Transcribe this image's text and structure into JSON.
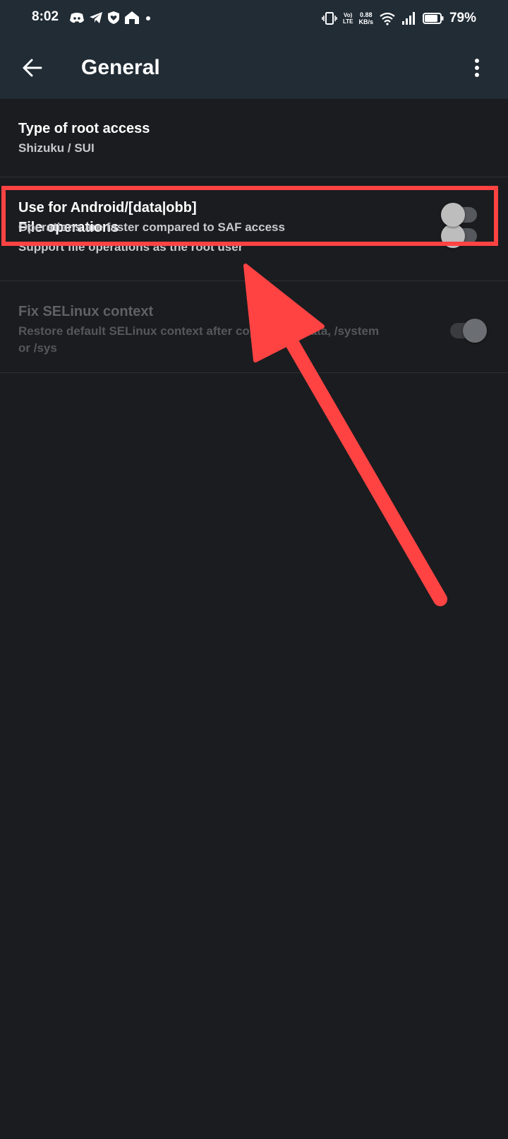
{
  "status_bar": {
    "time": "8:02",
    "volte_top": "Vo)",
    "volte_bottom": "LTE",
    "net_speed_value": "0.88",
    "net_speed_unit": "KB/s",
    "battery_percent": "79%",
    "left_icons": [
      "discord-icon",
      "telegram-icon",
      "shield-heart-icon",
      "home-icon",
      "notification-dot-icon"
    ],
    "right_icons": [
      "vibrate-icon",
      "volte-icon",
      "wifi-icon",
      "signal-icon",
      "battery-icon"
    ]
  },
  "app_bar": {
    "title": "General",
    "back_icon": "arrow-back-icon",
    "more_icon": "more-vert-icon"
  },
  "settings": [
    {
      "title": "Type of root access",
      "summary": "Shizuku / SUI",
      "has_toggle": false
    },
    {
      "title": "Use for Android/[data|obb]",
      "summary": "Operations are faster compared to SAF access",
      "has_toggle": true,
      "toggle_on": false,
      "enabled": true
    },
    {
      "title": "File operations",
      "summary": "Support file operations as the root user",
      "has_toggle": true,
      "toggle_on": false,
      "enabled": true
    },
    {
      "title": "Fix SELinux context",
      "summary_line1": "Restore default SELinux context after copying to /data, /system",
      "summary_line2": "or /sys",
      "has_toggle": true,
      "toggle_on": true,
      "enabled": false
    }
  ],
  "annotation": {
    "highlight_color": "#ff4343",
    "arrow_color": "#ff4343"
  },
  "colors": {
    "app_bar": "#212c35",
    "background": "#1b1c1f"
  }
}
